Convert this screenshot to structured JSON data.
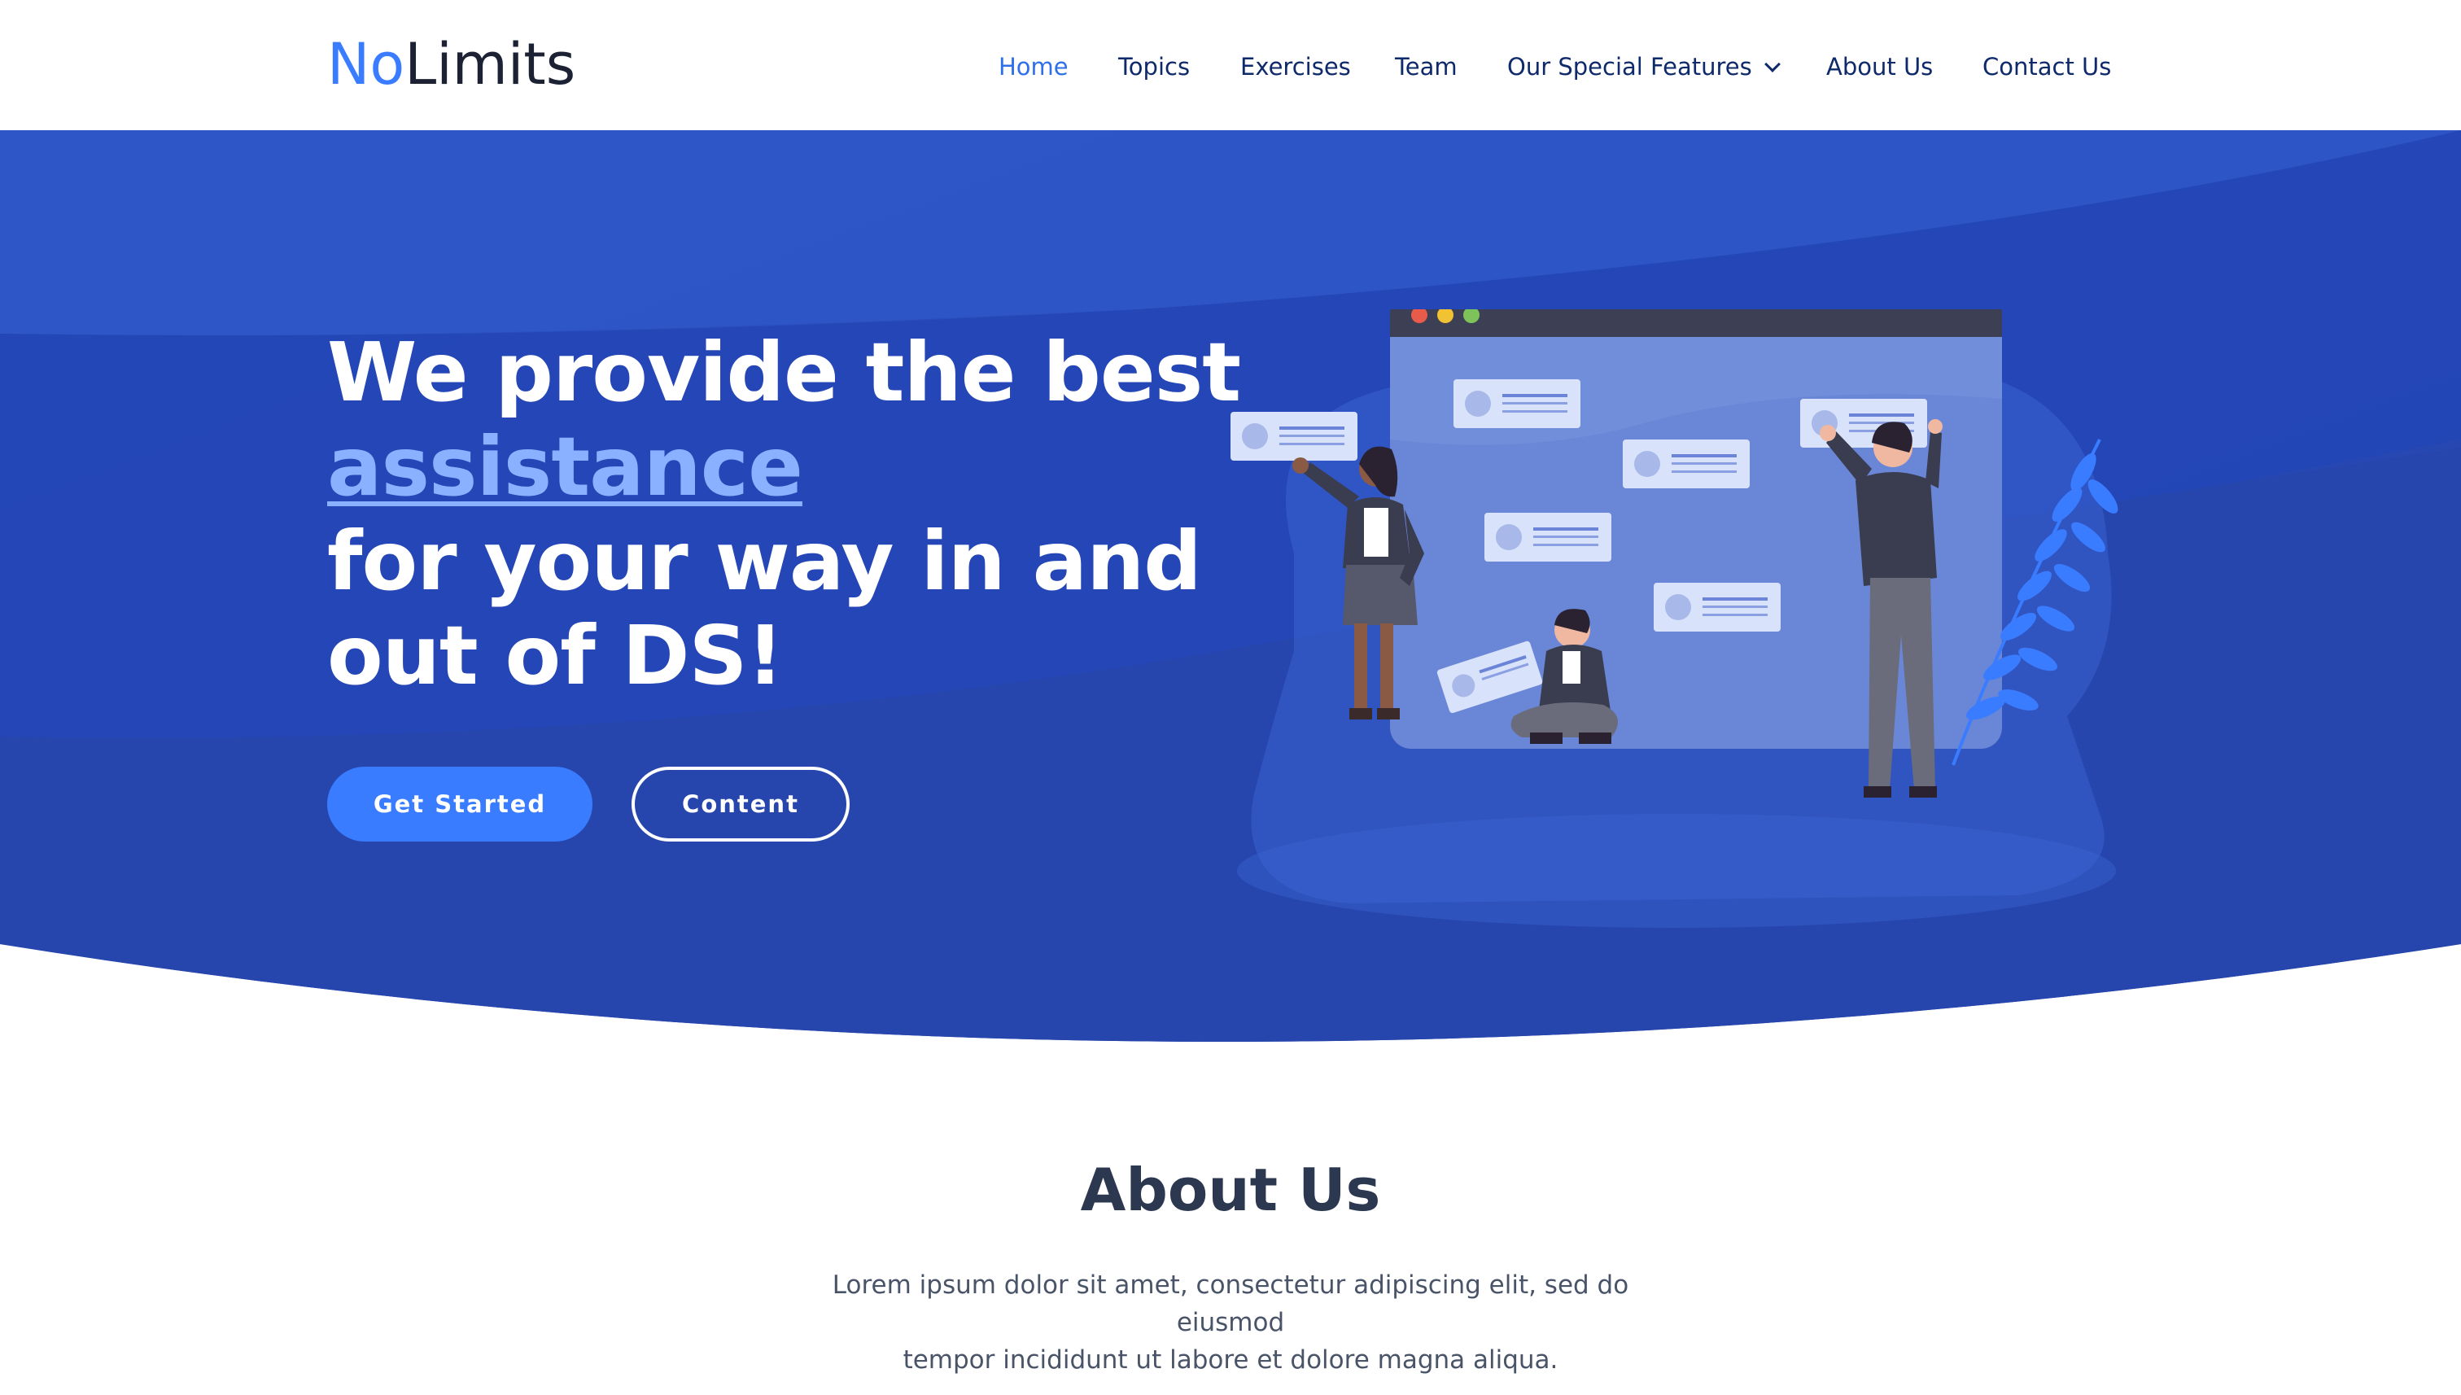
{
  "brand": {
    "part1": "No",
    "part2": "Limits"
  },
  "nav": {
    "home": "Home",
    "topics": "Topics",
    "exercises": "Exercises",
    "team": "Team",
    "features": "Our Special Features",
    "about": "About Us",
    "contact": "Contact Us"
  },
  "hero": {
    "line1": "We provide the best",
    "accent": "assistance",
    "line3": "for your way in and",
    "line4": "out of DS!",
    "primary_button": "Get Started",
    "secondary_button": "Content"
  },
  "about": {
    "title": "About Us",
    "text_line1": "Lorem ipsum dolor sit amet, consectetur adipiscing elit, sed do eiusmod",
    "text_line2": "tempor incididunt ut labore et dolore magna aliqua."
  },
  "colors": {
    "brand_blue": "#3a7cff",
    "nav_text": "#0e2a6a",
    "hero_bg": "#2548b8",
    "accent_text": "#8ab1ff"
  },
  "icons": [
    "chevron-down-icon",
    "team-illustration"
  ]
}
